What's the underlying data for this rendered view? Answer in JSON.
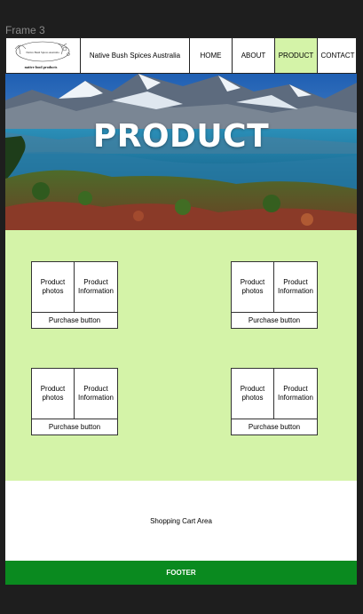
{
  "frame": {
    "label": "Frame 3"
  },
  "header": {
    "logo": {
      "top_text": "Native Bush Spices Australia",
      "bottom_text": "native food products"
    },
    "brand": "Native Bush Spices Australia",
    "nav": {
      "home": "HOME",
      "about": "ABOUT",
      "product": "PRODUCT",
      "contact": "CONTACT"
    },
    "active_nav": "PRODUCT"
  },
  "hero": {
    "title": "PRODUCT"
  },
  "products": [
    {
      "photos": "Product photos",
      "info": "Product Information",
      "purchase": "Purchase button"
    },
    {
      "photos": "Product photos",
      "info": "Product Information",
      "purchase": "Purchase button"
    },
    {
      "photos": "Product photos",
      "info": "Product Information",
      "purchase": "Purchase button"
    },
    {
      "photos": "Product photos",
      "info": "Product Information",
      "purchase": "Purchase button"
    }
  ],
  "cart": {
    "label": "Shopping Cart Area"
  },
  "footer": {
    "label": "FOOTER"
  },
  "colors": {
    "active_nav": "#d4f3a8",
    "product_area": "#d4f3a8",
    "footer": "#0a8a1f",
    "canvas": "#1e1e1e"
  }
}
